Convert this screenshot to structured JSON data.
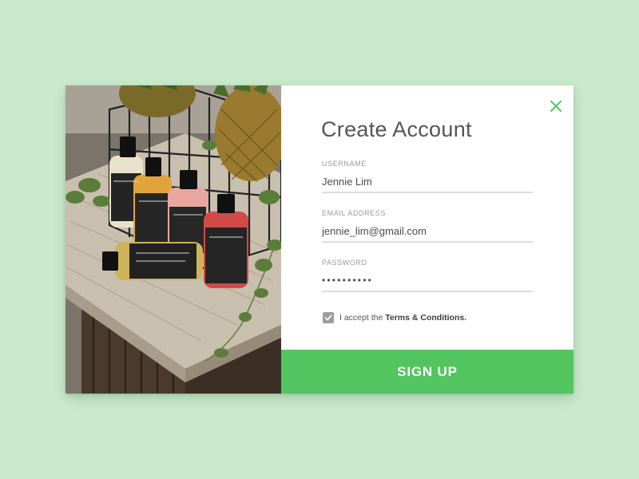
{
  "form": {
    "title": "Create Account",
    "username": {
      "label": "USERNAME",
      "value": "Jennie Lim"
    },
    "email": {
      "label": "EMAIL ADDRESS",
      "value": "jennie_lim@gmail.com"
    },
    "password": {
      "label": "PASSWORD",
      "value": "••••••••••"
    },
    "terms": {
      "checked": true,
      "prefix": "I accept the",
      "link": "Terms & Conditions."
    },
    "submit_label": "SIGN UP"
  },
  "icons": {
    "close": "close-icon",
    "check": "check-icon"
  },
  "colors": {
    "background": "#c9ebcb",
    "accent": "#53c560",
    "checkbox": "#9d9d9d"
  }
}
